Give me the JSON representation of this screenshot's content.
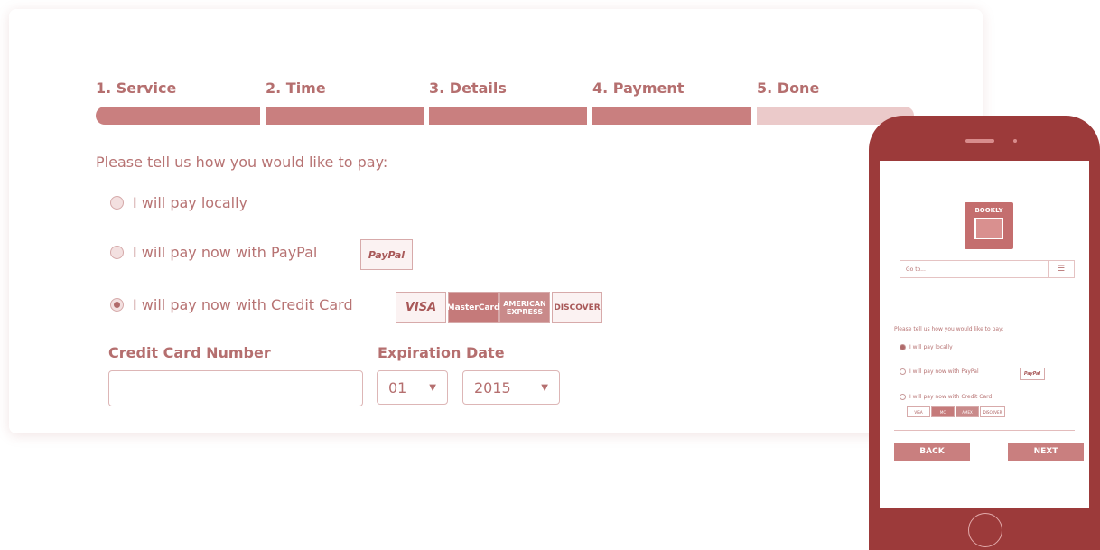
{
  "steps": [
    {
      "label": "1. Service",
      "done": true
    },
    {
      "label": "2. Time",
      "done": true
    },
    {
      "label": "3. Details",
      "done": true
    },
    {
      "label": "4. Payment",
      "done": true
    },
    {
      "label": "5. Done",
      "done": false
    }
  ],
  "payment": {
    "prompt": "Please tell us how you would like to pay:",
    "options": [
      {
        "label": "I will pay locally",
        "checked": false
      },
      {
        "label": "I will pay now with PayPal",
        "checked": false
      },
      {
        "label": "I will pay now with Credit Card",
        "checked": true
      }
    ],
    "paypal_badge": "PayPal",
    "cards": [
      "VISA",
      "MasterCard",
      "AMERICAN EXPRESS",
      "DISCOVER"
    ]
  },
  "form": {
    "cc_label": "Credit Card Number",
    "cc_value": "",
    "exp_label": "Expiration Date",
    "month": "01",
    "year": "2015"
  },
  "mobile": {
    "logo_text": "BOOKLY",
    "search_placeholder": "Go to...",
    "menu_icon": "hamburger-icon",
    "prompt": "Please tell us how you would like to pay:",
    "options": [
      {
        "label": "I will pay locally",
        "checked": true
      },
      {
        "label": "I will pay now with PayPal",
        "checked": false
      },
      {
        "label": "I will pay now with Credit Card",
        "checked": false
      }
    ],
    "paypal_badge": "PayPal",
    "cards": [
      "VISA",
      "MC",
      "AMEX",
      "DISCOVER"
    ],
    "back_label": "BACK",
    "next_label": "NEXT"
  },
  "colors": {
    "accent": "#c97f7f",
    "pending": "#ebcaca",
    "phone": "#9c3a3a",
    "text": "#b77373"
  }
}
